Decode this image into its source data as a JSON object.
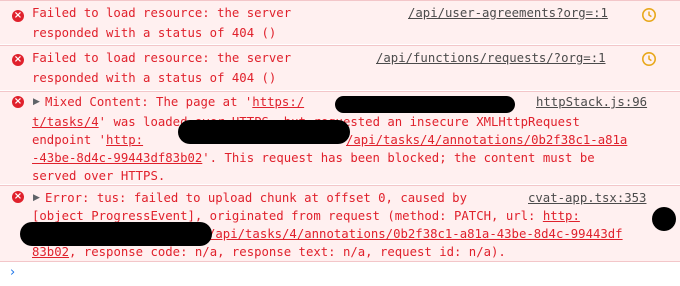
{
  "console": {
    "entries": [
      {
        "level": "error",
        "lines": [
          "Failed to load resource: the server",
          "responded with a status of 404 ()"
        ],
        "source": "/api/user-agreements?org=:1",
        "ext_icon": "clock-refresh-icon"
      },
      {
        "level": "error",
        "lines": [
          "Failed to load resource: the server",
          "responded with a status of 404 ()"
        ],
        "source": "/api/functions/requests/?org=:1",
        "ext_icon": "clock-refresh-icon"
      },
      {
        "level": "error",
        "expander": "▶",
        "line1_prefix": "Mixed Content: The page at '",
        "line1_link": "https:/",
        "line2_link": "t/tasks/4",
        "line2_rest": "' was loaded over HTTPS, but requested an insecure XMLHttpRequest",
        "line3_prefix": "endpoint '",
        "line3_link_start": "http:",
        "line3_link_end": "/api/tasks/4/annotations/0b2f38c1-a81a",
        "line4_link": "-43be-8d4c-99443df83b02",
        "line4_rest": "'. This request has been blocked; the content must be",
        "line5": "served over HTTPS.",
        "source": "httpStack.js:96"
      },
      {
        "level": "error",
        "expander": "▶",
        "line1": "Error: tus: failed to upload chunk at offset 0, caused by",
        "line2_prefix": "[object ProgressEvent], originated from request (method: PATCH, url: ",
        "line2_link": "http:",
        "line3_link": "/api/tasks/4/annotations/0b2f38c1-a81a-43be-8d4c-99443df",
        "line4_link": "83b02",
        "line4_rest": ", response code: n/a, response text: n/a, request id: n/a).",
        "source": "cvat-app.tsx:353"
      }
    ],
    "prompt_symbol": "›"
  },
  "colors": {
    "error_text": "#e0212c",
    "error_bg": "#fff0f0",
    "error_border": "#f3c6c9",
    "prompt": "#1a73e8",
    "redaction": "#000000"
  }
}
